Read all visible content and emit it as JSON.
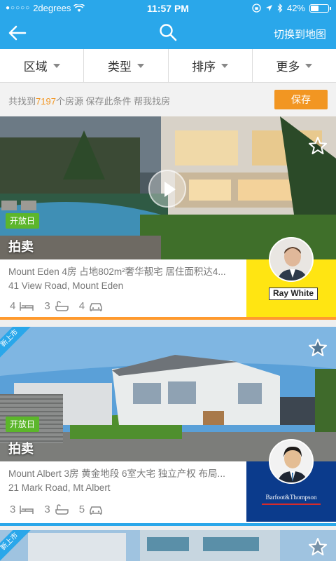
{
  "status_bar": {
    "carrier": "2degrees",
    "time": "11:57 PM",
    "battery_percent": "42%",
    "battery_level": 0.42
  },
  "nav": {
    "map_label": "切换到地图"
  },
  "filters": [
    {
      "label": "区域"
    },
    {
      "label": "类型"
    },
    {
      "label": "排序"
    },
    {
      "label": "更多"
    }
  ],
  "results": {
    "prefix": "共找到",
    "count": "7197",
    "suffix": "个房源 保存此条件 帮我找房",
    "save_label": "保存"
  },
  "listings": [
    {
      "open_badge": "开放日",
      "sale_method": "拍卖",
      "title": "Mount Eden 4房 占地802m²奢华靓宅 居住面积达4...",
      "address": "41 View Road, Mount Eden",
      "bedrooms": "4",
      "bathrooms": "3",
      "parking": "4",
      "agency": "Ray White",
      "agency_color": "#ffe512"
    },
    {
      "new_ribbon": "新上市",
      "open_badge": "开放日",
      "sale_method": "拍卖",
      "title": "Mount Albert 3房 黄金地段 6室大宅 独立产权 布局...",
      "address": "21 Mark Road, Mt Albert",
      "bedrooms": "3",
      "bathrooms": "3",
      "parking": "5",
      "agency": "Barfoot&Thompson",
      "agency_color": "#0b3b8c"
    },
    {
      "new_ribbon": "新上市"
    }
  ],
  "colors": {
    "accent": "#2aa7ea",
    "orange": "#f29622",
    "green": "#5cb62b"
  }
}
